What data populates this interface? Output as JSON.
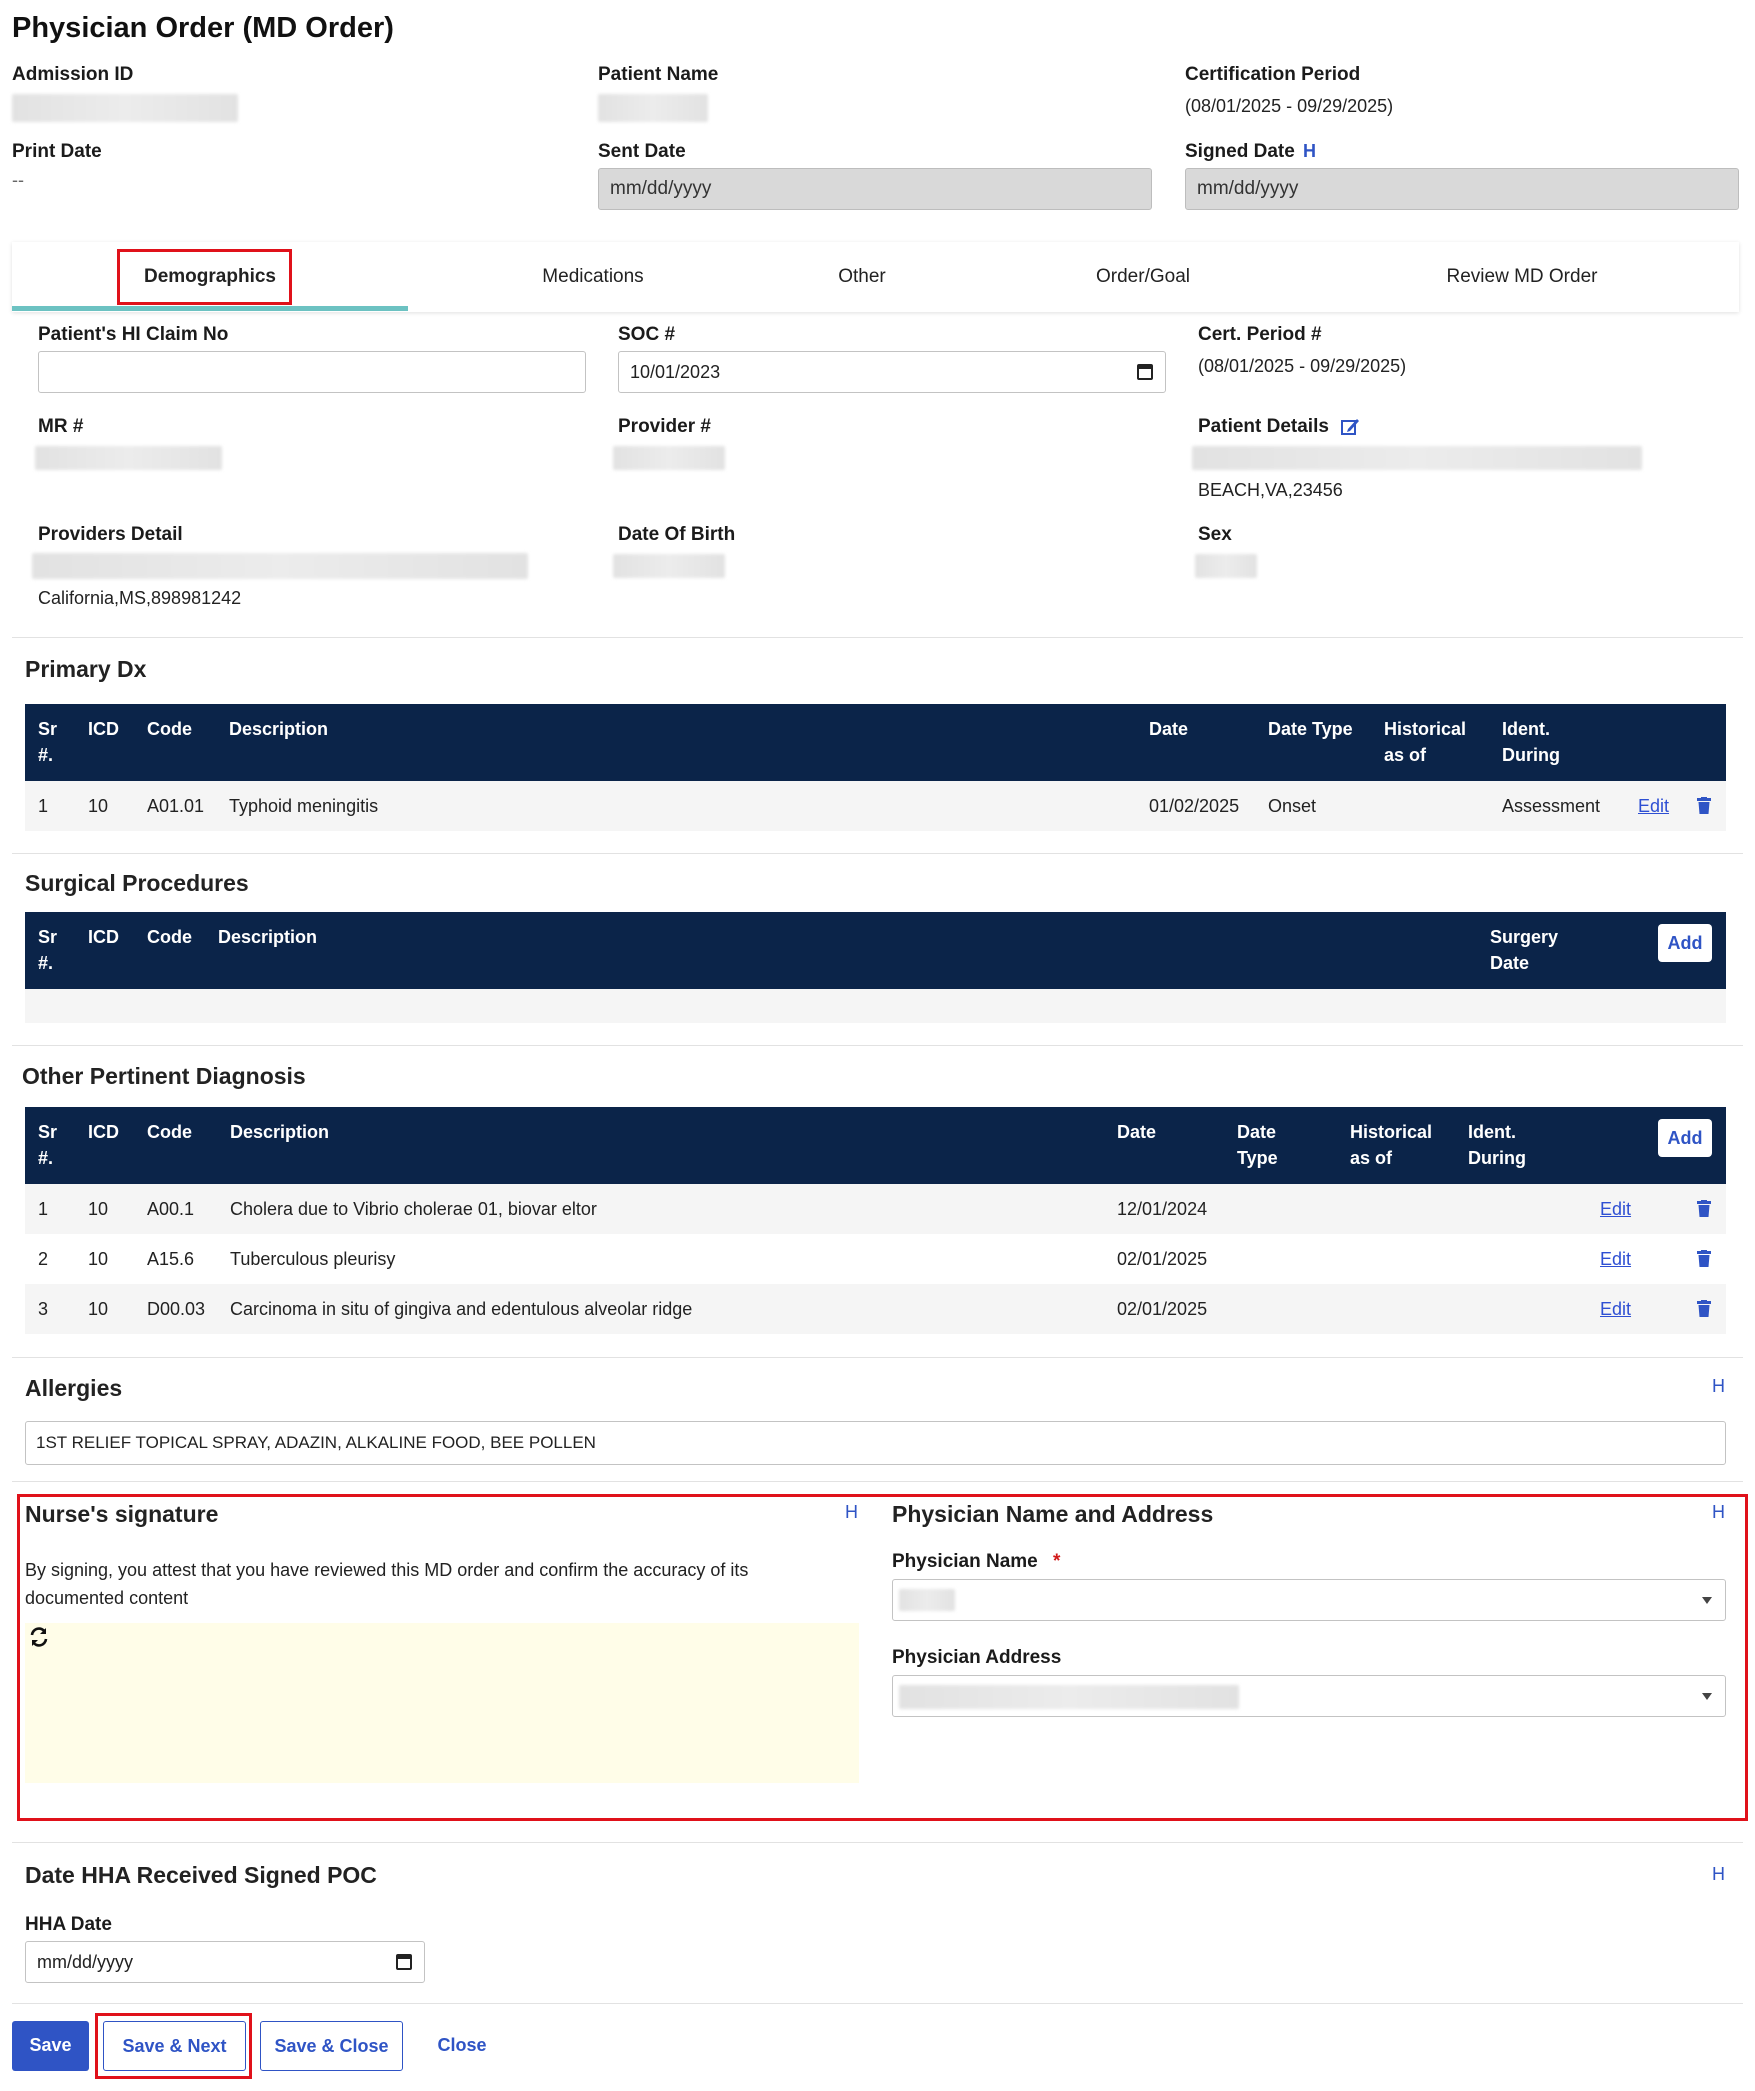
{
  "header": {
    "title": "Physician Order (MD Order)",
    "admission_id_label": "Admission ID",
    "patient_name_label": "Patient Name",
    "certification_period_label": "Certification Period",
    "certification_period_value": "(08/01/2025 - 09/29/2025)",
    "print_date_label": "Print Date",
    "print_date_value": "--",
    "sent_date_label": "Sent Date",
    "sent_date_placeholder": "mm/dd/yyyy",
    "signed_date_label": "Signed Date",
    "signed_date_h": "H",
    "signed_date_placeholder": "mm/dd/yyyy"
  },
  "tabs": [
    "Demographics",
    "Medications",
    "Other",
    "Order/Goal",
    "Review MD Order"
  ],
  "demographics": {
    "hi_claim_label": "Patient's HI Claim No",
    "hi_claim_value": "",
    "soc_label": "SOC #",
    "soc_value": "10/01/2023",
    "cert_period_label": "Cert. Period #",
    "cert_period_value": "(08/01/2025 - 09/29/2025)",
    "mr_label": "MR #",
    "provider_label": "Provider #",
    "patient_details_label": "Patient Details",
    "patient_details_address": "BEACH,VA,23456",
    "providers_detail_label": "Providers Detail",
    "providers_detail_address": "California,MS,898981242",
    "dob_label": "Date Of Birth",
    "sex_label": "Sex"
  },
  "primary_dx": {
    "title": "Primary Dx",
    "headers": [
      "Sr #.",
      "ICD",
      "Code",
      "Description",
      "Date",
      "Date Type",
      "Historical as of",
      "Ident. During"
    ],
    "rows": [
      {
        "sr": "1",
        "icd": "10",
        "code": "A01.01",
        "description": "Typhoid meningitis",
        "date": "01/02/2025",
        "date_type": "Onset",
        "historical": "",
        "ident": "Assessment",
        "edit": "Edit"
      }
    ]
  },
  "surgical_procedures": {
    "title": "Surgical Procedures",
    "headers": [
      "Sr #.",
      "ICD",
      "Code",
      "Description",
      "Surgery Date"
    ],
    "add_label": "Add"
  },
  "other_dx": {
    "title": "Other Pertinent Diagnosis",
    "headers": [
      "Sr #.",
      "ICD",
      "Code",
      "Description",
      "Date",
      "Date Type",
      "Historical as of",
      "Ident. During"
    ],
    "add_label": "Add",
    "rows": [
      {
        "sr": "1",
        "icd": "10",
        "code": "A00.1",
        "description": "Cholera due to Vibrio cholerae 01, biovar eltor",
        "date": "12/01/2024",
        "edit": "Edit"
      },
      {
        "sr": "2",
        "icd": "10",
        "code": "A15.6",
        "description": "Tuberculous pleurisy",
        "date": "02/01/2025",
        "edit": "Edit"
      },
      {
        "sr": "3",
        "icd": "10",
        "code": "D00.03",
        "description": "Carcinoma in situ of gingiva and edentulous alveolar ridge",
        "date": "02/01/2025",
        "edit": "Edit"
      }
    ]
  },
  "allergies": {
    "title": "Allergies",
    "h": "H",
    "value": "1ST RELIEF TOPICAL SPRAY, ADAZIN, ALKALINE FOOD, BEE POLLEN"
  },
  "nurse_signature": {
    "title": "Nurse's signature",
    "h": "H",
    "attestation": "By signing, you attest that you have reviewed this MD order and confirm the accuracy of its documented content"
  },
  "physician": {
    "title": "Physician Name and Address",
    "h": "H",
    "name_label": "Physician Name",
    "required_mark": "*",
    "address_label": "Physician Address"
  },
  "hha": {
    "title": "Date HHA Received Signed POC",
    "h": "H",
    "date_label": "HHA Date",
    "date_placeholder": "mm/dd/yyyy"
  },
  "footer": {
    "save": "Save",
    "save_next": "Save & Next",
    "save_close": "Save & Close",
    "close": "Close"
  },
  "colors": {
    "table_header": "#0b2449",
    "accent": "#2f54c5",
    "tab_underline": "#6cc2c2",
    "highlight_box": "#e0111a",
    "signature_bg": "#fffde8"
  }
}
